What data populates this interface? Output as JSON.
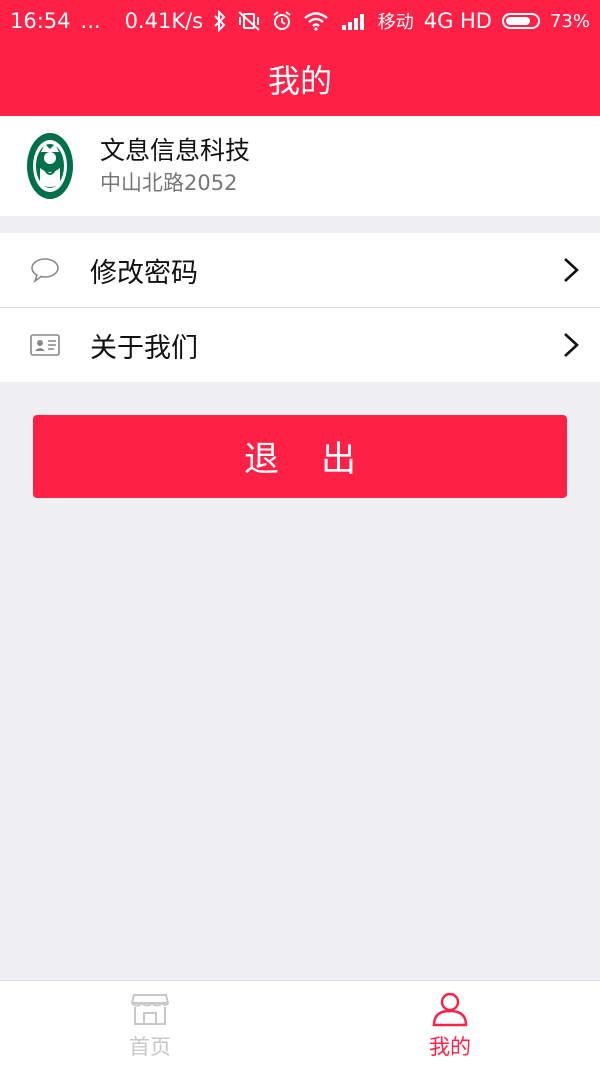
{
  "status_bar": {
    "time": "16:54",
    "dots": "...",
    "speed": "0.41K/s",
    "carrier": "移动",
    "network": "4G HD",
    "battery": "73%",
    "icons": [
      "bluetooth-icon",
      "vibrate-off-icon",
      "alarm-icon",
      "wifi-icon",
      "signal-icon",
      "battery-icon"
    ]
  },
  "header": {
    "title": "我的"
  },
  "profile": {
    "name": "文息信息科技",
    "address": "中山北路2052",
    "logo": "starbucks-logo"
  },
  "menu": {
    "items": [
      {
        "label": "修改密码",
        "icon": "chat-bubble-icon"
      },
      {
        "label": "关于我们",
        "icon": "id-card-icon"
      }
    ]
  },
  "logout": {
    "label": "退出"
  },
  "tabbar": {
    "tabs": [
      {
        "label": "首页",
        "icon": "store-icon",
        "active": false
      },
      {
        "label": "我的",
        "icon": "user-icon",
        "active": true
      }
    ]
  },
  "colors": {
    "accent": "#ff2046",
    "background": "#efeff4",
    "inactive": "#c8c8c8"
  }
}
